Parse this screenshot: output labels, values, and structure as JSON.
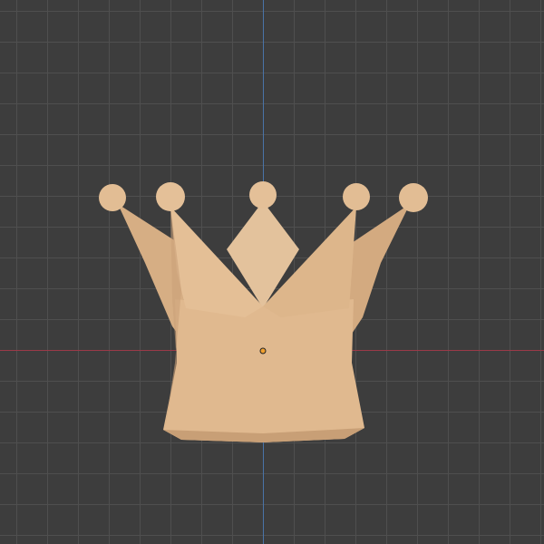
{
  "viewport": {
    "object": "crown",
    "colors": {
      "background": "#3d3d3d",
      "grid": "#4f4f4f",
      "x_axis": "#9b3a48",
      "y_axis": "#4a74a8",
      "crown_light": "#e6c39b",
      "crown_mid": "#ddb68b",
      "crown_dark": "#c9a078",
      "origin": "#f0a030"
    }
  }
}
